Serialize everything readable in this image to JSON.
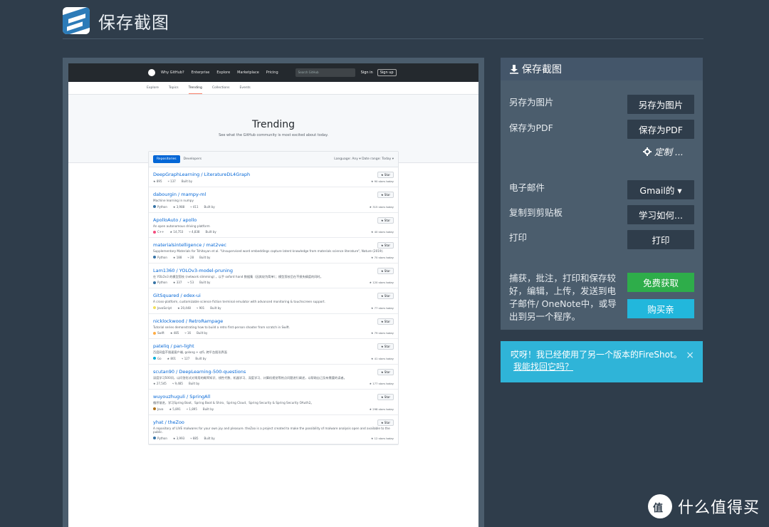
{
  "app": {
    "title": "保存截图"
  },
  "preview": {
    "topbar": {
      "nav": [
        "Why GitHub?",
        "Enterprise",
        "Explore",
        "Marketplace",
        "Pricing"
      ],
      "search_placeholder": "Search GitHub",
      "signin": "Sign in",
      "signup": "Sign up"
    },
    "subnav": [
      "Explore",
      "Topics",
      "Trending",
      "Collections",
      "Events"
    ],
    "hero": {
      "title": "Trending",
      "subtitle": "See what the GitHub community is most excited about today."
    },
    "tabs": {
      "repositories": "Repositories",
      "developers": "Developers"
    },
    "filters": "Language: Any ▾    Date range: Today ▾",
    "star_label": "★ Star",
    "repos": [
      {
        "name": "DeepGraphLearning / LiteratureDL4Graph",
        "desc": "",
        "lang": "",
        "lang_color": "#cccccc",
        "stars": "★ 895",
        "forks": "⑂ 137",
        "built_by": "Built by",
        "today": "★ 90 stars today"
      },
      {
        "name": "dabourgin / mampy-ml",
        "desc": "Machine learning in numpy",
        "lang": "Python",
        "lang_color": "#3572A5",
        "stars": "★ 3,988",
        "forks": "⑂ 411",
        "built_by": "Built by",
        "today": "★ 315 stars today"
      },
      {
        "name": "ApolloAuto / apollo",
        "desc": "An open autonomous driving platform",
        "lang": "C++",
        "lang_color": "#f34b7d",
        "stars": "★ 14,753",
        "forks": "⑂ 4,838",
        "built_by": "Built by",
        "today": "★ 40 stars today"
      },
      {
        "name": "materialsintelligence / mat2vec",
        "desc": "Supplementary Materials for Tshitoyan et al. \"Unsupervised word embeddings capture latent knowledge from materials science literature\", Nature (2019).",
        "lang": "Python",
        "lang_color": "#3572A5",
        "stars": "★ 188",
        "forks": "⑂ 28",
        "built_by": "Built by",
        "today": "★ 70 stars today"
      },
      {
        "name": "Lam1360 / YOLOv3-model-pruning",
        "desc": "在 YOLOv3 的模型剪枝 (network slimming) ，以手 oxford hand 数据集（因其较为简单）；模型剪枝后在不损失精度的同时。",
        "lang": "Python",
        "lang_color": "#3572A5",
        "stars": "★ 337",
        "forks": "⑂ 53",
        "built_by": "Built by",
        "today": "★ 120 stars today"
      },
      {
        "name": "GitSquared / edex-ui",
        "desc": "A cross-platform, customizable science fiction terminal emulator with advanced monitoring & touchscreen support.",
        "lang": "JavaScript",
        "lang_color": "#f1e05a",
        "stars": "★ 20,448",
        "forks": "⑂ 901",
        "built_by": "Built by",
        "today": "★ 77 stars today"
      },
      {
        "name": "nicklockwood / RetroRampage",
        "desc": "Tutorial series demonstrating how to build a retro first-person shooter from scratch in Swift.",
        "lang": "Swift",
        "lang_color": "#ffac45",
        "stars": "★ 485",
        "forks": "⑂ 16",
        "built_by": "Built by",
        "today": "★ 79 stars today"
      },
      {
        "name": "pateliq / pan-light",
        "desc": "百度网盘不限速客户端, golang + qt5, 跨平台图形界面",
        "lang": "Go",
        "lang_color": "#00ADD8",
        "stars": "★ 801",
        "forks": "⑂ 127",
        "built_by": "Built by",
        "today": "★ 41 stars today"
      },
      {
        "name": "scutan90 / DeepLearning-500-questions",
        "desc": "深度学习500问，以问答形式对常用的概率知识、线性代数、机器学习、深度学习、计算机视觉等热点问题进行阐述，以帮助自己及有需要的读者。",
        "lang": "",
        "lang_color": "#cccccc",
        "stars": "★ 27,545",
        "forks": "⑂ 9,485",
        "built_by": "Built by",
        "today": "★ 177 stars today"
      },
      {
        "name": "wuyouzhuguli / SpringAll",
        "desc": "循序渐进，学习Spring Boot、Spring Boot & Shiro、Spring Cloud、Spring Security & Spring Security OAuth2。",
        "lang": "Java",
        "lang_color": "#b07219",
        "stars": "★ 5,891",
        "forks": "⑂ 1,895",
        "built_by": "Built by",
        "today": "★ 298 stars today"
      },
      {
        "name": "yhat / theZoo",
        "desc": "A repository of LIVE malwares for your own joy and pleasure. theZoo is a project created to make the possibility of malware analysis open and available to the public.",
        "lang": "Python",
        "lang_color": "#3572A5",
        "stars": "★ 3,993",
        "forks": "⑂ 885",
        "built_by": "Built by",
        "today": "★ 12 stars today"
      }
    ]
  },
  "side": {
    "header": "保存截图",
    "save_image_label": "另存为图片",
    "save_image_btn": "另存为图片",
    "save_pdf_label": "保存为PDF",
    "save_pdf_btn": "保存为PDF",
    "custom": "定制 ...",
    "email_label": "电子邮件",
    "email_btn": "Gmail的 ▾",
    "clipboard_label": "复制到剪贴板",
    "clipboard_btn": "学习如何...",
    "print_label": "打印",
    "print_btn": "打印",
    "description": "捕获，批注，打印和保存较好，编辑，上传，发送到电子邮件/ OneNote中，或导出到另一个程序。",
    "free_btn": "免费获取",
    "buy_btn": "购买亲"
  },
  "info": {
    "text": "哎呀！我已经使用了另一个版本的FireShot。",
    "link": "我能找回它吗？",
    "close": "×"
  },
  "watermark": {
    "logo": "值",
    "text": "什么值得买"
  }
}
